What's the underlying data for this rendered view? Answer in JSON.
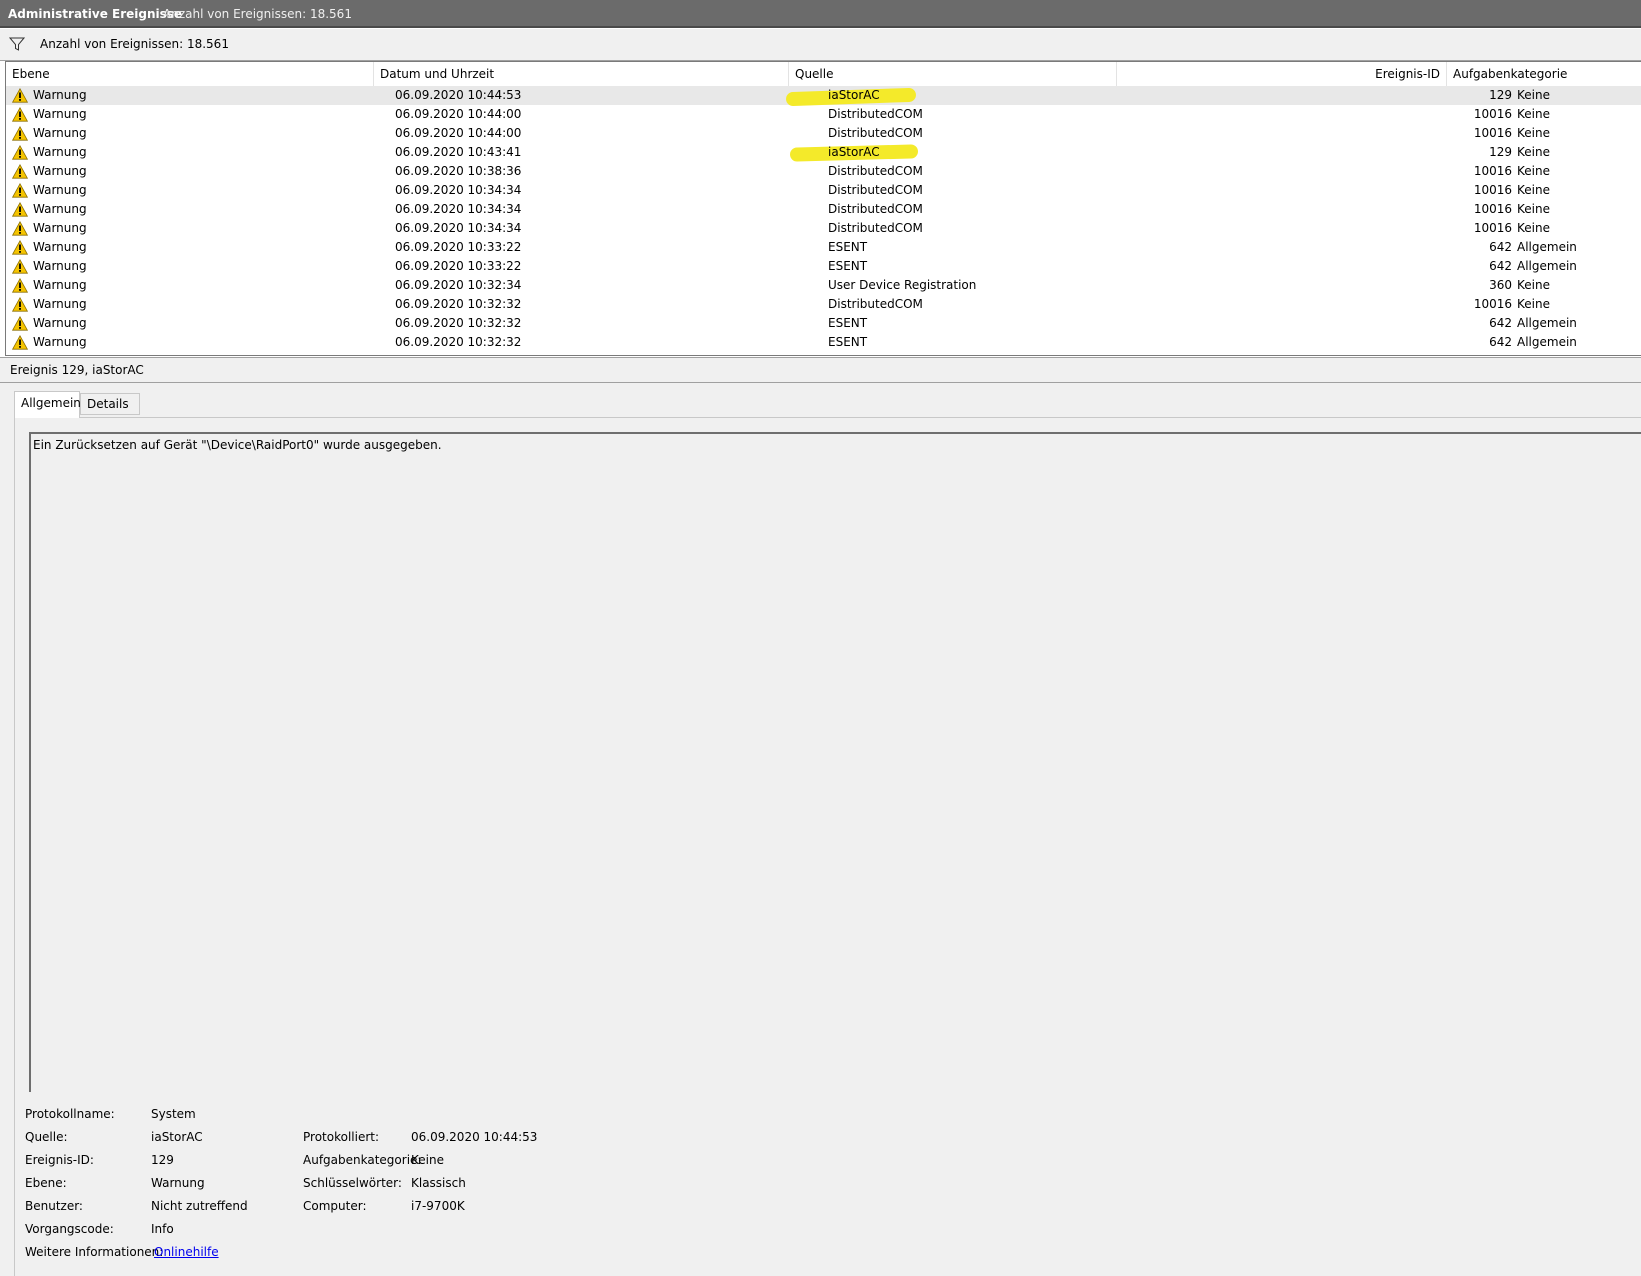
{
  "title_bar": {
    "title": "Administrative Ereignisse",
    "count_text": "Anzahl von Ereignissen: 18.561"
  },
  "filter_bar": {
    "icon": "filter-icon",
    "text": "Anzahl von Ereignissen: 18.561"
  },
  "columns": [
    "Ebene",
    "Datum und Uhrzeit",
    "Quelle",
    "Ereignis-ID",
    "Aufgabenkategorie"
  ],
  "events": [
    {
      "level": "Warnung",
      "date": "06.09.2020 10:44:53",
      "source": "iaStorAC",
      "id": "129",
      "category": "Keine"
    },
    {
      "level": "Warnung",
      "date": "06.09.2020 10:44:00",
      "source": "DistributedCOM",
      "id": "10016",
      "category": "Keine"
    },
    {
      "level": "Warnung",
      "date": "06.09.2020 10:44:00",
      "source": "DistributedCOM",
      "id": "10016",
      "category": "Keine"
    },
    {
      "level": "Warnung",
      "date": "06.09.2020 10:43:41",
      "source": "iaStorAC",
      "id": "129",
      "category": "Keine"
    },
    {
      "level": "Warnung",
      "date": "06.09.2020 10:38:36",
      "source": "DistributedCOM",
      "id": "10016",
      "category": "Keine"
    },
    {
      "level": "Warnung",
      "date": "06.09.2020 10:34:34",
      "source": "DistributedCOM",
      "id": "10016",
      "category": "Keine"
    },
    {
      "level": "Warnung",
      "date": "06.09.2020 10:34:34",
      "source": "DistributedCOM",
      "id": "10016",
      "category": "Keine"
    },
    {
      "level": "Warnung",
      "date": "06.09.2020 10:34:34",
      "source": "DistributedCOM",
      "id": "10016",
      "category": "Keine"
    },
    {
      "level": "Warnung",
      "date": "06.09.2020 10:33:22",
      "source": "ESENT",
      "id": "642",
      "category": "Allgemein"
    },
    {
      "level": "Warnung",
      "date": "06.09.2020 10:33:22",
      "source": "ESENT",
      "id": "642",
      "category": "Allgemein"
    },
    {
      "level": "Warnung",
      "date": "06.09.2020 10:32:34",
      "source": "User Device Registration",
      "id": "360",
      "category": "Keine"
    },
    {
      "level": "Warnung",
      "date": "06.09.2020 10:32:32",
      "source": "DistributedCOM",
      "id": "10016",
      "category": "Keine"
    },
    {
      "level": "Warnung",
      "date": "06.09.2020 10:32:32",
      "source": "ESENT",
      "id": "642",
      "category": "Allgemein"
    },
    {
      "level": "Warnung",
      "date": "06.09.2020 10:32:32",
      "source": "ESENT",
      "id": "642",
      "category": "Allgemein"
    }
  ],
  "highlight_color": "#f4ea2a",
  "warning_color": "#f5c400",
  "detail": {
    "header": "Ereignis 129, iaStorAC",
    "tabs": [
      "Allgemein",
      "Details"
    ],
    "message": "Ein Zurücksetzen auf Gerät \"\\Device\\RaidPort0\" wurde ausgegeben.",
    "props": {
      "log_name_label": "Protokollname:",
      "log_name": "System",
      "source_label": "Quelle:",
      "source": "iaStorAC",
      "logged_label": "Protokolliert:",
      "logged": "06.09.2020 10:44:53",
      "event_id_label": "Ereignis-ID:",
      "event_id": "129",
      "task_cat_label": "Aufgabenkategorie:",
      "task_cat": "Keine",
      "level_label": "Ebene:",
      "level": "Warnung",
      "keywords_label": "Schlüsselwörter:",
      "keywords": "Klassisch",
      "user_label": "Benutzer:",
      "user": "Nicht zutreffend",
      "computer_label": "Computer:",
      "computer": "i7-9700K",
      "opcode_label": "Vorgangscode:",
      "opcode": "Info",
      "more_info_label": "Weitere Informationen:",
      "more_info_link": "Onlinehilfe"
    }
  }
}
